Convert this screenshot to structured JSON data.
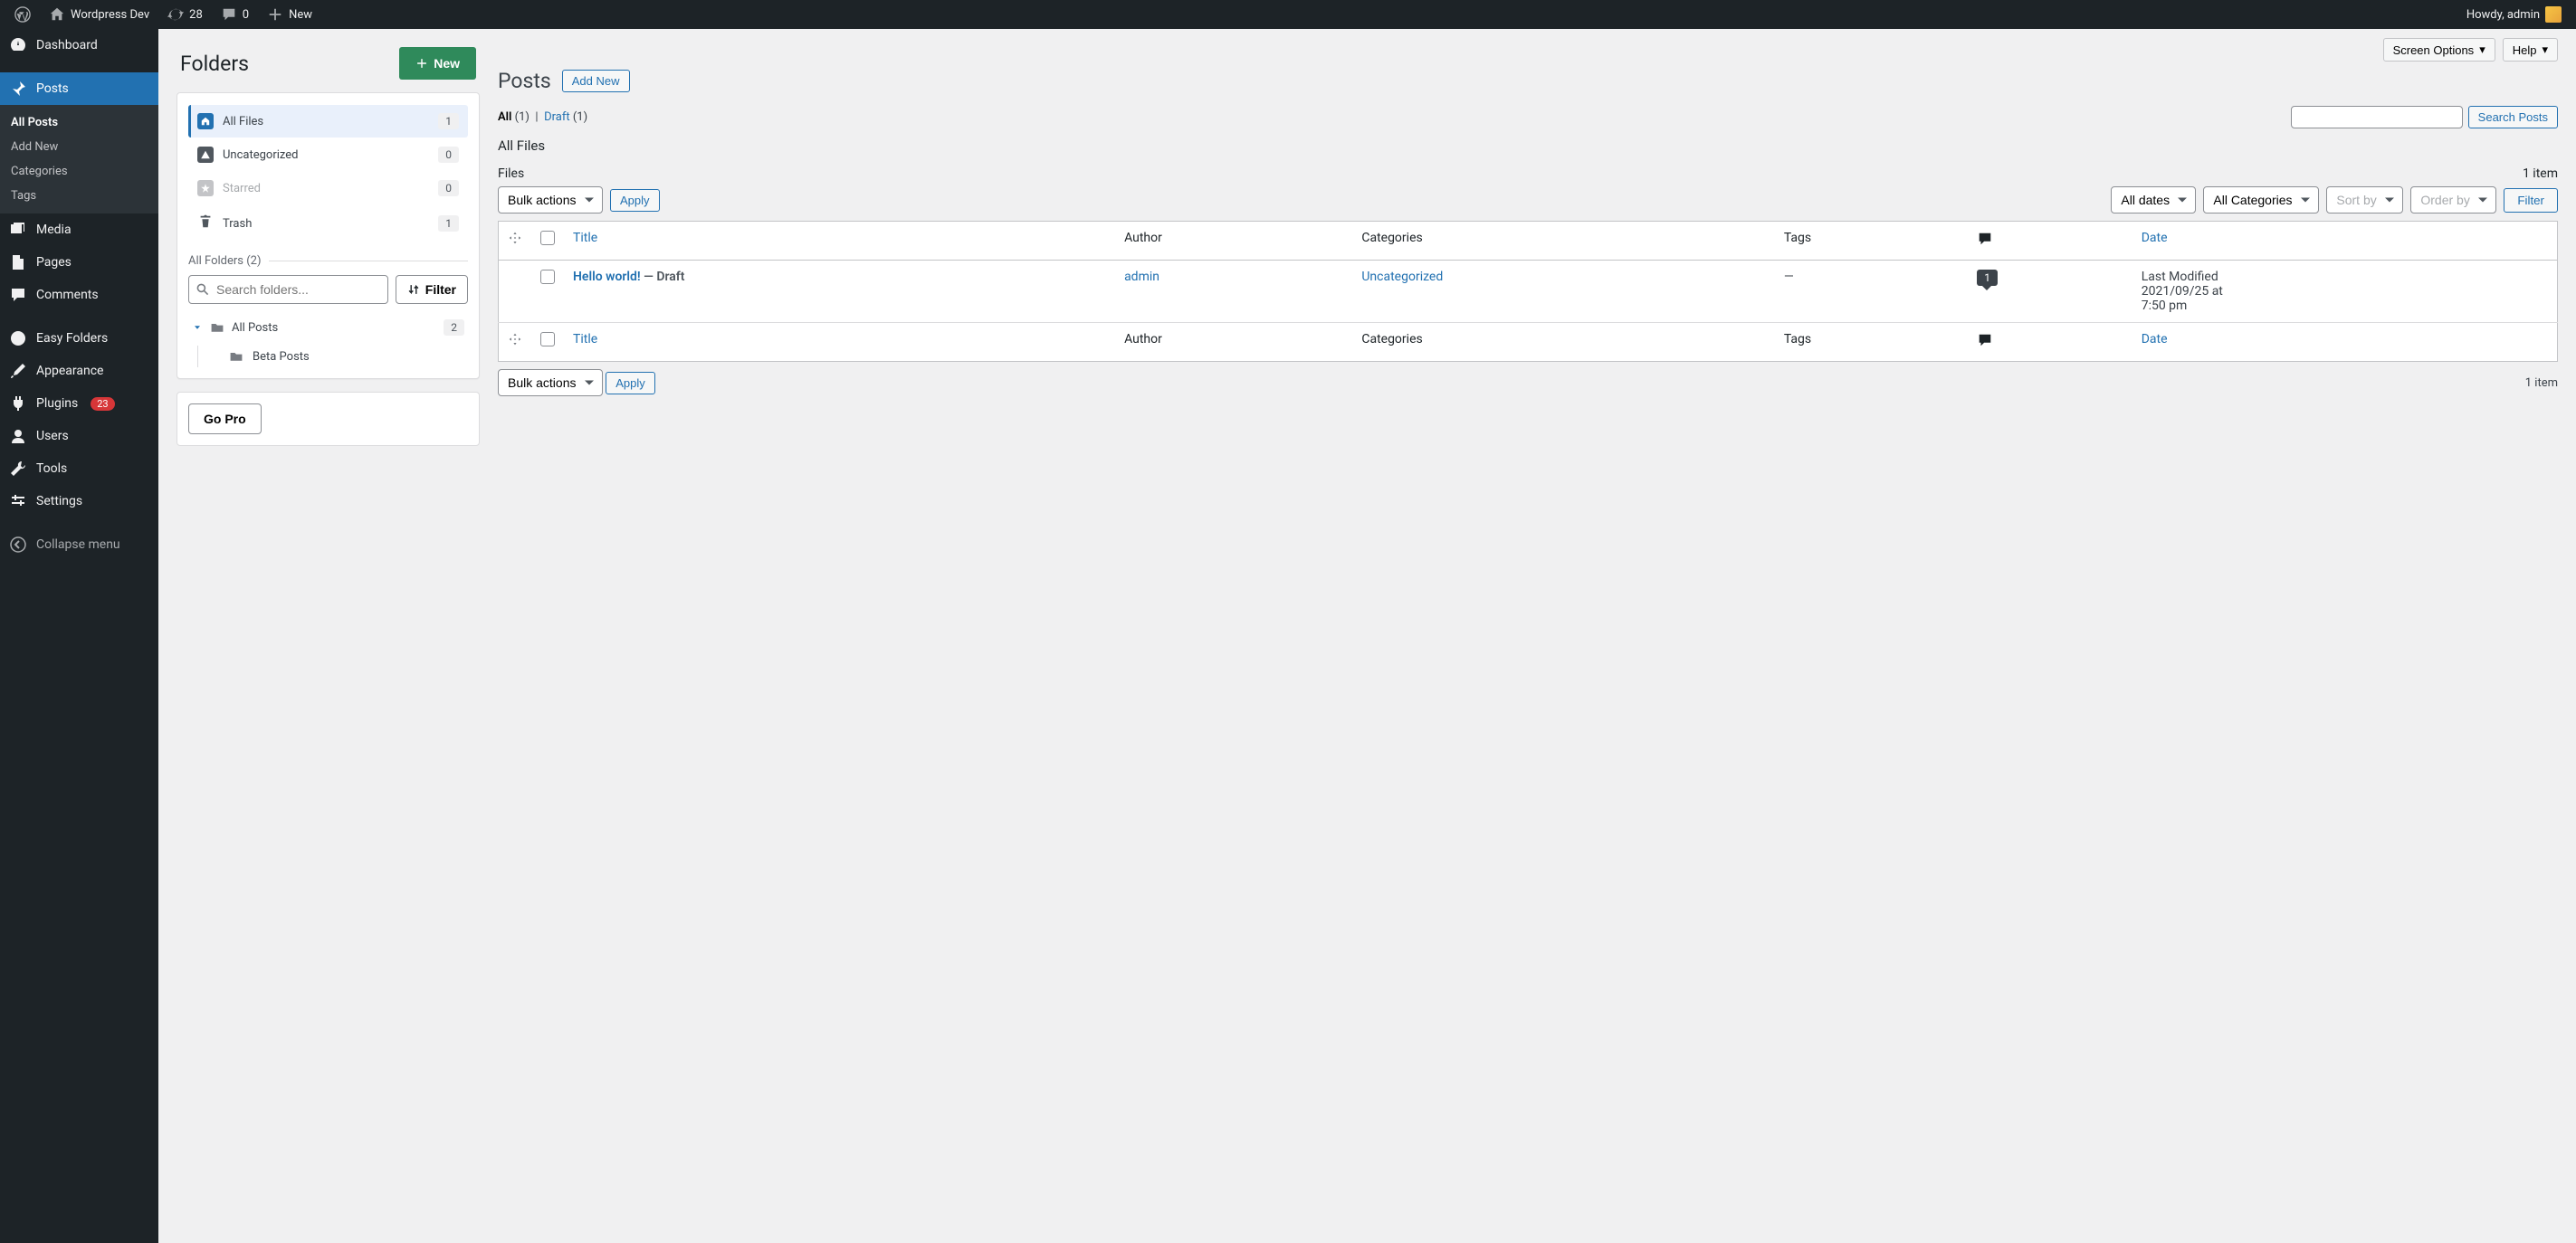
{
  "adminbar": {
    "site_name": "Wordpress Dev",
    "updates": "28",
    "comments": "0",
    "new": "New",
    "howdy": "Howdy, admin"
  },
  "menu": {
    "dashboard": "Dashboard",
    "posts": "Posts",
    "posts_sub": {
      "all": "All Posts",
      "add": "Add New",
      "cats": "Categories",
      "tags": "Tags"
    },
    "media": "Media",
    "pages": "Pages",
    "comments": "Comments",
    "easy_folders": "Easy Folders",
    "appearance": "Appearance",
    "plugins": "Plugins",
    "plugins_badge": "23",
    "users": "Users",
    "tools": "Tools",
    "settings": "Settings",
    "collapse": "Collapse menu"
  },
  "folders": {
    "title": "Folders",
    "new_btn": "New",
    "rows": {
      "all_files": {
        "label": "All Files",
        "count": "1"
      },
      "uncat": {
        "label": "Uncategorized",
        "count": "0"
      },
      "starred": {
        "label": "Starred",
        "count": "0"
      },
      "trash": {
        "label": "Trash",
        "count": "1"
      }
    },
    "section": "All Folders (2)",
    "search_ph": "Search folders...",
    "filter_btn": "Filter",
    "tree": {
      "root": {
        "label": "All Posts",
        "count": "2"
      },
      "child": {
        "label": "Beta Posts"
      }
    },
    "go_pro": "Go Pro"
  },
  "content": {
    "screen_options": "Screen Options",
    "help": "Help",
    "title": "Posts",
    "add_new": "Add New",
    "subsub": {
      "all_label": "All",
      "all_count": "(1)",
      "sep": "|",
      "draft_label": "Draft",
      "draft_count": "(1)"
    },
    "search_btn": "Search Posts",
    "current_folder": "All Files",
    "files_label": "Files",
    "item_count": "1 item",
    "bulk": "Bulk actions",
    "apply": "Apply",
    "all_dates": "All dates",
    "all_cats": "All Categories",
    "sort_by": "Sort by",
    "order_by": "Order by",
    "filter": "Filter",
    "columns": {
      "title": "Title",
      "author": "Author",
      "categories": "Categories",
      "tags": "Tags",
      "date": "Date"
    },
    "row": {
      "title": "Hello world!",
      "state": " — Draft",
      "author": "admin",
      "category": "Uncategorized",
      "tags": "—",
      "comments": "1",
      "date_l1": "Last Modified",
      "date_l2": "2021/09/25 at",
      "date_l3": "7:50 pm"
    }
  }
}
